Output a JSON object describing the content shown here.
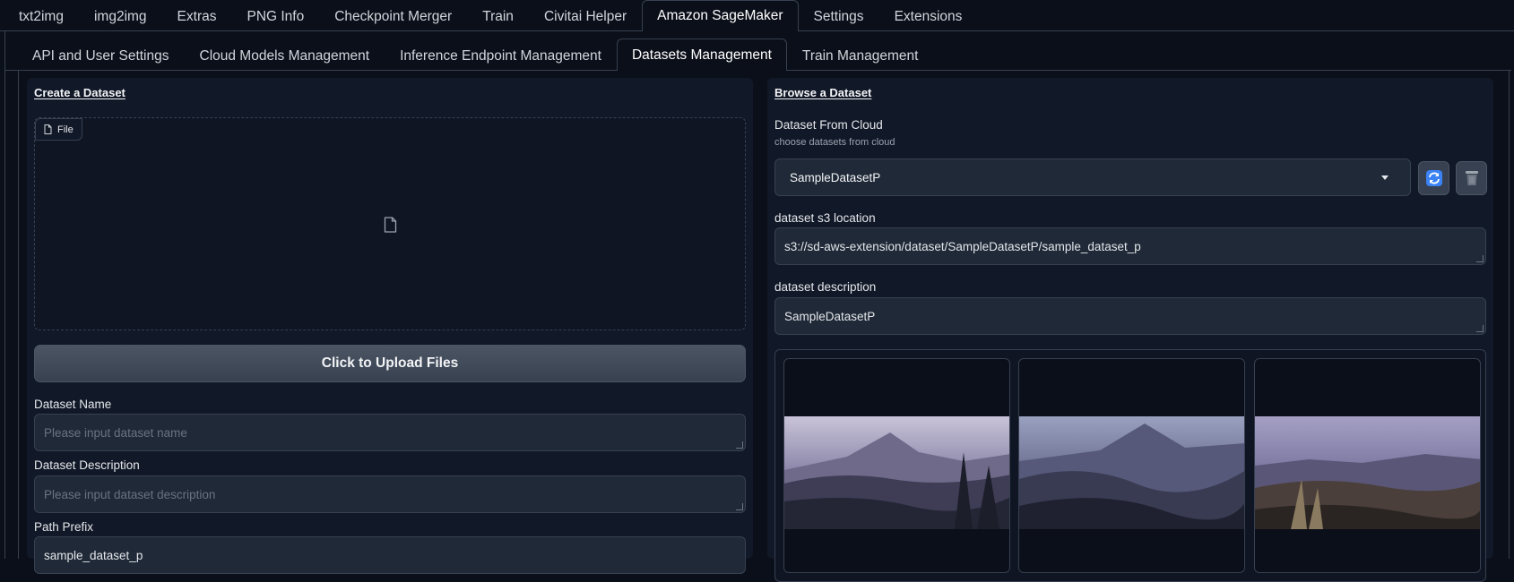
{
  "top_tabs": [
    {
      "label": "txt2img"
    },
    {
      "label": "img2img"
    },
    {
      "label": "Extras"
    },
    {
      "label": "PNG Info"
    },
    {
      "label": "Checkpoint Merger"
    },
    {
      "label": "Train"
    },
    {
      "label": "Civitai Helper"
    },
    {
      "label": "Amazon SageMaker",
      "active": true
    },
    {
      "label": "Settings"
    },
    {
      "label": "Extensions"
    }
  ],
  "sub_tabs": [
    {
      "label": "API and User Settings"
    },
    {
      "label": "Cloud Models Management"
    },
    {
      "label": "Inference Endpoint Management"
    },
    {
      "label": "Datasets Management",
      "active": true
    },
    {
      "label": "Train Management"
    }
  ],
  "create": {
    "title": "Create a Dataset",
    "file_badge": "File",
    "upload_button": "Click to Upload Files",
    "name_label": "Dataset Name",
    "name_placeholder": "Please input dataset name",
    "desc_label": "Dataset Description",
    "desc_placeholder": "Please input dataset description",
    "prefix_label": "Path Prefix",
    "prefix_value": "sample_dataset_p"
  },
  "browse": {
    "title": "Browse a Dataset",
    "cloud_label": "Dataset From Cloud",
    "cloud_sublabel": "choose datasets from cloud",
    "selected_dataset": "SampleDatasetP",
    "s3_label": "dataset s3 location",
    "s3_value": "s3://sd-aws-extension/dataset/SampleDatasetP/sample_dataset_p",
    "desc_label": "dataset description",
    "desc_value": "SampleDatasetP"
  },
  "icons": {
    "file": "file-icon",
    "refresh": "refresh-icon",
    "delete": "trash-icon",
    "dropdown": "chevron-down-icon"
  },
  "colors": {
    "background": "#0b0f19",
    "panel": "#111827",
    "input": "#1f2937",
    "border": "#374151"
  }
}
